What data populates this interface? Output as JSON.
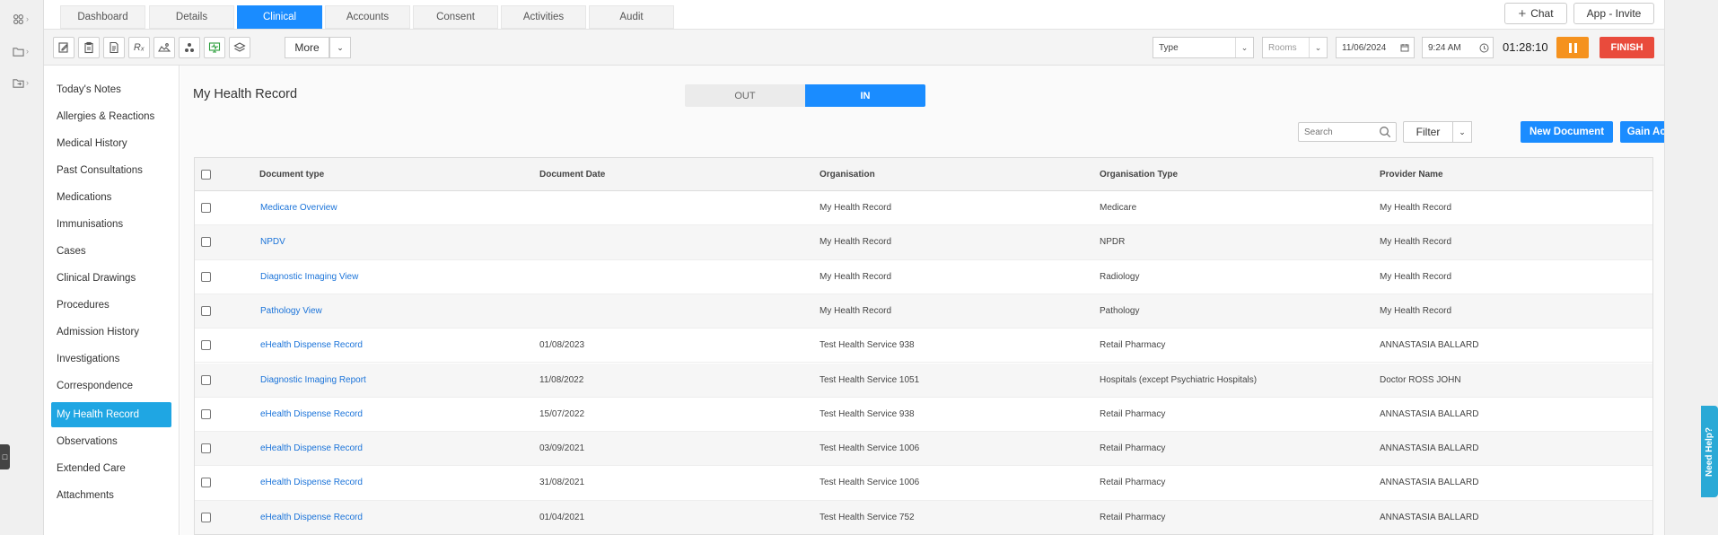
{
  "tabs": [
    "Dashboard",
    "Details",
    "Clinical",
    "Accounts",
    "Consent",
    "Activities",
    "Audit"
  ],
  "active_tab": "Clinical",
  "top_buttons": {
    "chat": "Chat",
    "app_invite": "App - Invite"
  },
  "toolbar": {
    "more_label": "More",
    "type_select": "Type",
    "rooms_select": "Rooms",
    "date": "11/06/2024",
    "time": "9:24 AM",
    "timer": "01:28:10",
    "finish_label": "FINISH"
  },
  "sidebar": {
    "items": [
      "Today's Notes",
      "Allergies & Reactions",
      "Medical History",
      "Past Consultations",
      "Medications",
      "Immunisations",
      "Cases",
      "Clinical Drawings",
      "Procedures",
      "Admission History",
      "Investigations",
      "Correspondence",
      "My Health Record",
      "Observations",
      "Extended Care",
      "Attachments"
    ],
    "active": "My Health Record"
  },
  "main": {
    "title": "My Health Record",
    "toggle_out": "OUT",
    "toggle_in": "IN",
    "search_placeholder": "Search",
    "filter_label": "Filter",
    "new_document_label": "New Document",
    "gain_access_label": "Gain Access"
  },
  "table": {
    "headers": [
      "Document type",
      "Document Date",
      "Organisation",
      "Organisation Type",
      "Provider Name"
    ],
    "rows": [
      [
        "Medicare Overview",
        "",
        "My Health Record",
        "Medicare",
        "My Health Record"
      ],
      [
        "NPDV",
        "",
        "My Health Record",
        "NPDR",
        "My Health Record"
      ],
      [
        "Diagnostic Imaging View",
        "",
        "My Health Record",
        "Radiology",
        "My Health Record"
      ],
      [
        "Pathology View",
        "",
        "My Health Record",
        "Pathology",
        "My Health Record"
      ],
      [
        "eHealth Dispense Record",
        "01/08/2023",
        "Test Health Service 938",
        "Retail Pharmacy",
        "ANNASTASIA BALLARD"
      ],
      [
        "Diagnostic Imaging Report",
        "11/08/2022",
        "Test Health Service 1051",
        "Hospitals (except Psychiatric Hospitals)",
        "Doctor ROSS JOHN"
      ],
      [
        "eHealth Dispense Record",
        "15/07/2022",
        "Test Health Service 938",
        "Retail Pharmacy",
        "ANNASTASIA BALLARD"
      ],
      [
        "eHealth Dispense Record",
        "03/09/2021",
        "Test Health Service 1006",
        "Retail Pharmacy",
        "ANNASTASIA BALLARD"
      ],
      [
        "eHealth Dispense Record",
        "31/08/2021",
        "Test Health Service 1006",
        "Retail Pharmacy",
        "ANNASTASIA BALLARD"
      ],
      [
        "eHealth Dispense Record",
        "01/04/2021",
        "Test Health Service 752",
        "Retail Pharmacy",
        "ANNASTASIA BALLARD"
      ]
    ]
  },
  "help_tab": "Need Help?",
  "colors": {
    "accent": "#1a8cff",
    "sidebar_active": "#1fa6e3",
    "pause": "#f5921e",
    "finish": "#e94b3c",
    "link": "#1a73d9"
  }
}
